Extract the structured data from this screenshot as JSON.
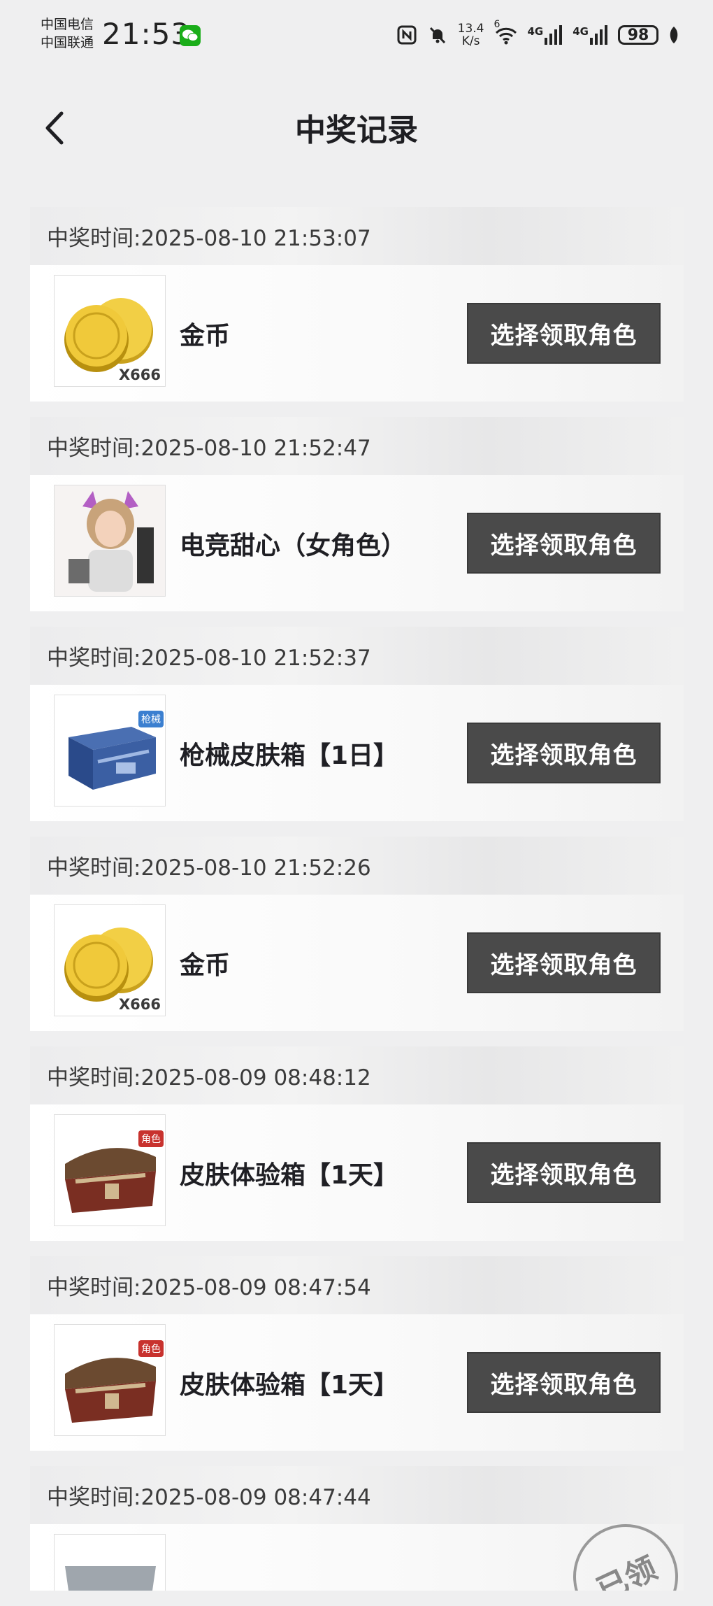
{
  "status_bar": {
    "carrier1": "中国电信",
    "carrier2": "中国联通",
    "time": "21:53",
    "net_speed_value": "13.4",
    "net_speed_unit": "K/s",
    "wifi_num": "6",
    "net1": "4G",
    "net2": "4G",
    "battery": "98"
  },
  "header": {
    "title": "中奖记录"
  },
  "records": [
    {
      "time": "中奖时间:2025-08-10 21:53:07",
      "prize": "金币",
      "qty": "X666",
      "tag": "",
      "button": "选择领取角色",
      "icon": "gold-coins"
    },
    {
      "time": "中奖时间:2025-08-10 21:52:47",
      "prize": "电竞甜心（女角色）",
      "qty": "",
      "tag": "",
      "button": "选择领取角色",
      "icon": "female-character"
    },
    {
      "time": "中奖时间:2025-08-10 21:52:37",
      "prize": "枪械皮肤箱【1日】",
      "qty": "",
      "tag": "枪械",
      "button": "选择领取角色",
      "icon": "weapon-skin-box"
    },
    {
      "time": "中奖时间:2025-08-10 21:52:26",
      "prize": "金币",
      "qty": "X666",
      "tag": "",
      "button": "选择领取角色",
      "icon": "gold-coins"
    },
    {
      "time": "中奖时间:2025-08-09 08:48:12",
      "prize": "皮肤体验箱【1天】",
      "qty": "",
      "tag": "角色",
      "button": "选择领取角色",
      "icon": "skin-trial-box"
    },
    {
      "time": "中奖时间:2025-08-09 08:47:54",
      "prize": "皮肤体验箱【1天】",
      "qty": "",
      "tag": "角色",
      "button": "选择领取角色",
      "icon": "skin-trial-box"
    },
    {
      "time": "中奖时间:2025-08-09 08:47:44",
      "prize": "",
      "qty": "",
      "tag": "",
      "button": "",
      "icon": "silver-box"
    }
  ],
  "stamp_text": "已领",
  "colors": {
    "button_bg": "#4a4a4a",
    "page_bg": "#efeff0",
    "weapon_tag": "#3b7fd0",
    "role_tag": "#c8322e"
  }
}
